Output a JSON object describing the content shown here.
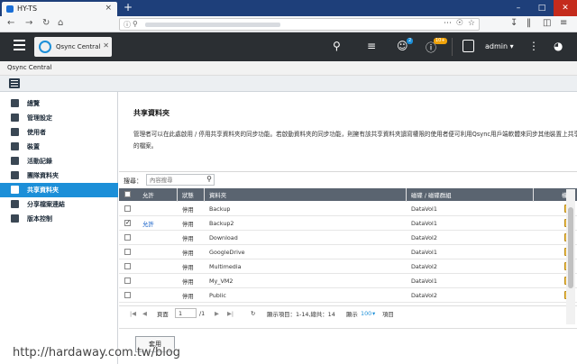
{
  "browser": {
    "tab_title": "HY-TS",
    "close_glyph": "×",
    "newtab_glyph": "+"
  },
  "qts": {
    "app_tab_label": "Qsync Central",
    "notification_count": "2",
    "event_badge": "10+",
    "user_label": "admin ▾"
  },
  "window": {
    "title": "Qsync Central"
  },
  "sidebar": {
    "items": [
      {
        "label": "總覽",
        "icon": "overview-icon"
      },
      {
        "label": "管理設定",
        "icon": "settings-icon"
      },
      {
        "label": "使用者",
        "icon": "user-icon"
      },
      {
        "label": "裝置",
        "icon": "device-icon"
      },
      {
        "label": "活動記錄",
        "icon": "log-icon"
      },
      {
        "label": "團隊資料夾",
        "icon": "team-folder-icon"
      },
      {
        "label": "共享資料夾",
        "icon": "shared-folder-icon"
      },
      {
        "label": "分享檔案連結",
        "icon": "share-link-icon"
      },
      {
        "label": "版本控制",
        "icon": "version-icon"
      }
    ],
    "active_index": 6
  },
  "main": {
    "title": "共享資料夾",
    "description_line1": "管理者可以在此處啟用 / 停用共享資料夾的同步功能。若啟動資料夾的同步功能，則擁有該共享資料夾讀寫權限的使用者便可利用Qsync用戶端軟體來同步其他裝置上共享資",
    "description_line2": "的檔案。",
    "search_label": "搜尋：",
    "search_placeholder": "內容搜尋",
    "columns": {
      "allow": "允許",
      "status": "狀態",
      "folder": "資料夾",
      "volume": "磁碟 / 磁碟群組",
      "permission": "權限"
    },
    "rows": [
      {
        "checked": false,
        "allow": "",
        "status": "停用",
        "folder": "Backup",
        "volume": "DataVol1"
      },
      {
        "checked": true,
        "allow": "允許",
        "status": "停用",
        "folder": "Backup2",
        "volume": "DataVol1"
      },
      {
        "checked": false,
        "allow": "",
        "status": "停用",
        "folder": "Download",
        "volume": "DataVol2"
      },
      {
        "checked": false,
        "allow": "",
        "status": "停用",
        "folder": "GoogleDrive",
        "volume": "DataVol1"
      },
      {
        "checked": false,
        "allow": "",
        "status": "停用",
        "folder": "Multimedia",
        "volume": "DataVol2"
      },
      {
        "checked": false,
        "allow": "",
        "status": "停用",
        "folder": "My_VM2",
        "volume": "DataVol1"
      },
      {
        "checked": false,
        "allow": "",
        "status": "停用",
        "folder": "Public",
        "volume": "DataVol2"
      }
    ],
    "pager": {
      "page_label": "頁面",
      "page_value": "1",
      "page_total": "/1",
      "display_text": "顯示項目：1-14,總共：14",
      "show_label": "顯示",
      "page_size": "100",
      "page_size_unit": "項目"
    },
    "apply_label": "套用"
  },
  "watermark": "http://hardaway.com.tw/blog"
}
